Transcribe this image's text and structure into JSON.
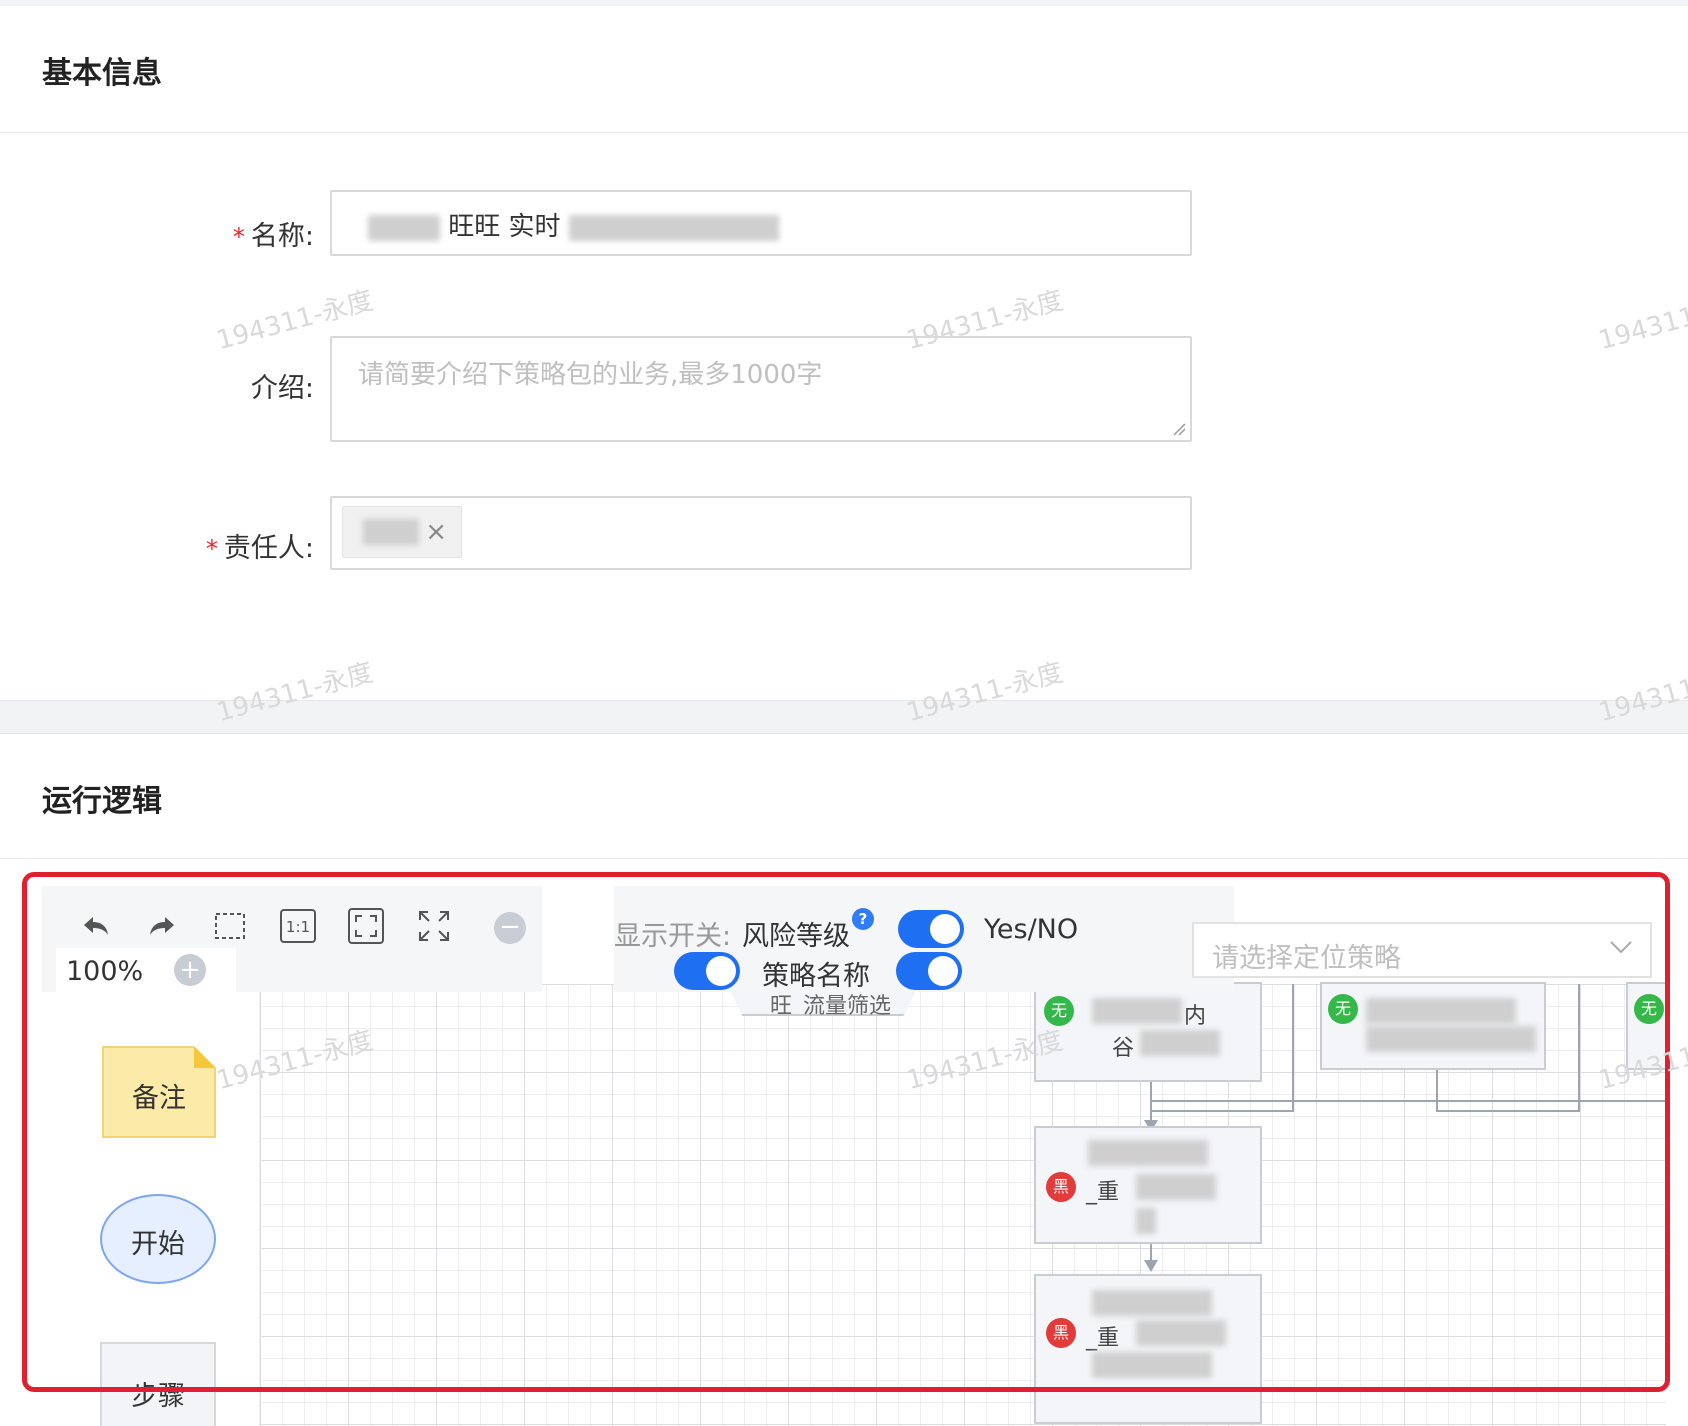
{
  "basic_info": {
    "title": "基本信息",
    "name_label": "名称:",
    "name_value": "旺旺 实时",
    "intro_label": "介绍:",
    "intro_placeholder": "请简要介绍下策略包的业务,最多1000字",
    "owner_label": "责任人:",
    "owner_remove": "×",
    "required_mark": "*"
  },
  "logic": {
    "title": "运行逻辑"
  },
  "watermark_text": "194311-永度",
  "toolbar": {
    "zoom": "100%",
    "zoom_in": "+",
    "zoom_out": "−",
    "fit_label": "1:1",
    "icons": [
      "undo-icon",
      "redo-icon",
      "marquee-select-icon",
      "actual-size-icon",
      "fit-screen-icon",
      "fullscreen-icon",
      "zoom-in-icon",
      "zoom-out-icon"
    ]
  },
  "display_switch": {
    "label": "显示开关:",
    "risk_level": "风险等级",
    "help": "?",
    "yes_no": "Yes/NO",
    "strategy_name": "策略名称",
    "risk_level_on": true,
    "yes_no_on": true,
    "strategy_name_on": true
  },
  "locate_select": {
    "placeholder": "请选择定位策略"
  },
  "palette": {
    "note": "备注",
    "start": "开始",
    "step": "步骤"
  },
  "flow": {
    "node_partial": "内",
    "node_partial2": "谷",
    "badge_none": "无",
    "badge_black": "黑",
    "node_text_red": "_重",
    "top_node_text": "旺_流量筛选"
  },
  "colors": {
    "accent": "#1f6ff2",
    "required": "#f5222d",
    "highlight_frame": "#e0202f",
    "badge_green": "#34b84a",
    "badge_red": "#e23b3b"
  }
}
